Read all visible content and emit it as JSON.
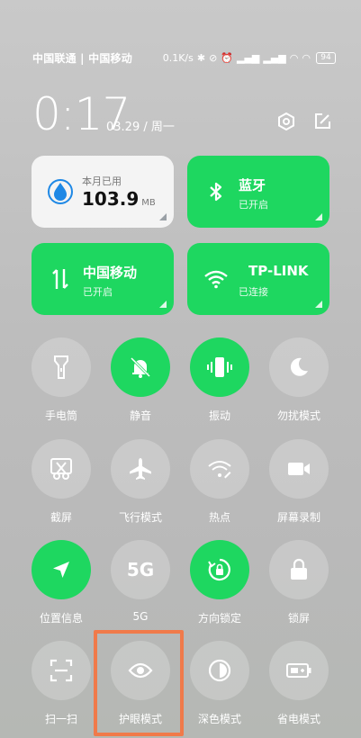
{
  "status_bar": {
    "carriers": "中国联通 | 中国移动",
    "net_speed": "0.1K/s",
    "battery": "94"
  },
  "header": {
    "time": "0:17",
    "date": "03.29 / 周一"
  },
  "tiles": {
    "data": {
      "label": "本月已用",
      "value": "103.9",
      "unit": "MB",
      "icon": "water-drop-icon"
    },
    "bluetooth": {
      "title": "蓝牙",
      "status": "已开启",
      "icon": "bluetooth-icon"
    },
    "mobile": {
      "title": "中国移动",
      "status": "已开启",
      "icon": "data-arrows-icon"
    },
    "wifi": {
      "title": "TP-LINK",
      "status": "已连接",
      "icon": "wifi-icon"
    }
  },
  "toggles": [
    {
      "label": "手电筒",
      "on": false,
      "icon": "flashlight-icon"
    },
    {
      "label": "静音",
      "on": true,
      "icon": "bell-off-icon"
    },
    {
      "label": "振动",
      "on": true,
      "icon": "vibrate-icon"
    },
    {
      "label": "勿扰模式",
      "on": false,
      "icon": "moon-icon"
    },
    {
      "label": "截屏",
      "on": false,
      "icon": "scissors-icon"
    },
    {
      "label": "飞行模式",
      "on": false,
      "icon": "airplane-icon"
    },
    {
      "label": "热点",
      "on": false,
      "icon": "hotspot-icon"
    },
    {
      "label": "屏幕录制",
      "on": false,
      "icon": "video-camera-icon"
    },
    {
      "label": "位置信息",
      "on": true,
      "icon": "location-icon"
    },
    {
      "label": "5G",
      "on": false,
      "icon": "5g-icon",
      "glyph": "5G"
    },
    {
      "label": "方向锁定",
      "on": true,
      "icon": "rotation-lock-icon"
    },
    {
      "label": "锁屏",
      "on": false,
      "icon": "lock-icon"
    },
    {
      "label": "扫一扫",
      "on": false,
      "icon": "scan-icon"
    },
    {
      "label": "护眼模式",
      "on": false,
      "icon": "eye-icon"
    },
    {
      "label": "深色模式",
      "on": false,
      "icon": "dark-mode-icon"
    },
    {
      "label": "省电模式",
      "on": false,
      "icon": "battery-saver-icon"
    }
  ],
  "colors": {
    "accent_green": "#1ed760",
    "highlight_orange": "#f07a4a"
  }
}
